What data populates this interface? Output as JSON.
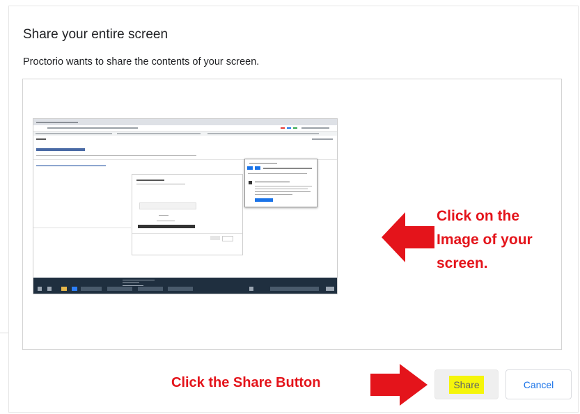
{
  "dialog": {
    "title": "Share your entire screen",
    "message": "Proctorio wants to share the contents of your screen."
  },
  "screen_thumbnail": {
    "description_icon": "desktop-screen-thumbnail"
  },
  "annotations": {
    "click_image": [
      "Click on the",
      "Image of your",
      "screen."
    ],
    "click_share": "Click the Share Button",
    "arrow_color": "#e4141b"
  },
  "buttons": {
    "share_label": "Share",
    "cancel_label": "Cancel",
    "highlight_color": "#f5f50a",
    "accent": "#1a73e8"
  }
}
